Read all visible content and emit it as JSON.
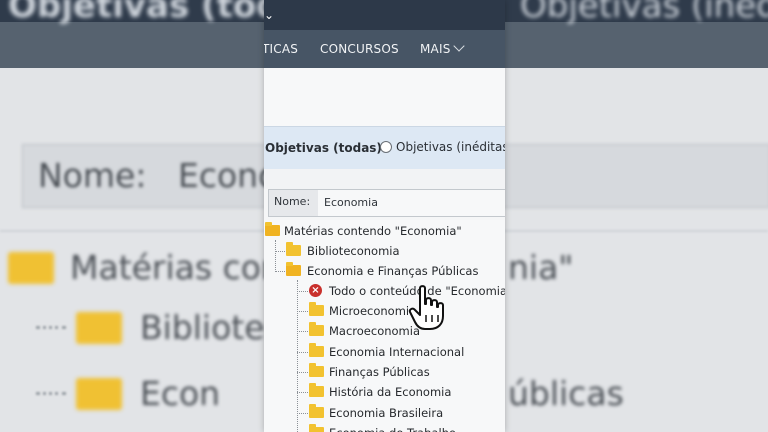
{
  "header": {
    "title": "Objetivas (todas)",
    "title_right": "Objetivas (inéditas)"
  },
  "nav": {
    "partial_item": "TICAS",
    "concursos": "CONCURSOS",
    "mais": "MAIS"
  },
  "filter": {
    "option_all": "Objetivas (todas)",
    "option_new": "Objetivas (inéditas)"
  },
  "search": {
    "label": "Nome:",
    "value": "Economia"
  },
  "tree": {
    "root": "Matérias contendo \"Economia\"",
    "items": [
      {
        "label": "Biblioteconomia"
      },
      {
        "label": "Economia e Finanças Públicas"
      }
    ],
    "children": [
      {
        "label": "Todo o conteúdo de \"Economia e F"
      },
      {
        "label": "Microeconomia"
      },
      {
        "label": "Macroeconomia"
      },
      {
        "label": "Economia Internacional"
      },
      {
        "label": "Finanças Públicas"
      },
      {
        "label": "História da Economia"
      },
      {
        "label": "Economia Brasileira"
      },
      {
        "label": "Economia do Trabalho"
      }
    ]
  },
  "background": {
    "name_label": "Nome:",
    "name_value": "Econo",
    "tree_root": "Matérias cont",
    "tree_root_tail": "nia\"",
    "item1": "Bibliote",
    "item2": "Econ",
    "item2_tail": "úblicas"
  },
  "colors": {
    "topbar": "#2d3949",
    "navbar": "#475565",
    "folder": "#f2c230",
    "error": "#c9302c"
  }
}
